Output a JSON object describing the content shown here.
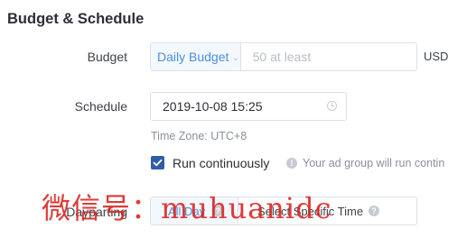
{
  "section": {
    "title": "Budget & Schedule"
  },
  "budget": {
    "label": "Budget",
    "type_selected": "Daily Budget",
    "amount_placeholder": "50 at least",
    "amount_value": "",
    "currency": "USD"
  },
  "schedule": {
    "label": "Schedule",
    "start": "2019-10-08 15:25",
    "timezone": "Time Zone: UTC+8",
    "run_continuously_label": "Run continuously",
    "run_continuously_checked": true,
    "hint": "Your ad group will run contin"
  },
  "dayparting": {
    "label": "Dayparting",
    "options": [
      "All Day",
      "Select Specific Time"
    ],
    "selected": "All Day"
  },
  "watermark": "微信号：muhuanidc",
  "icons": {
    "chevron": "chevron-down-icon",
    "clock": "clock-icon",
    "check": "check-icon",
    "info": "info-icon"
  },
  "colors": {
    "accent": "#4b8fd8",
    "checkbox": "#2f5ea6",
    "segment_bg": "#f3f8fd",
    "watermark": "#d9211e"
  }
}
